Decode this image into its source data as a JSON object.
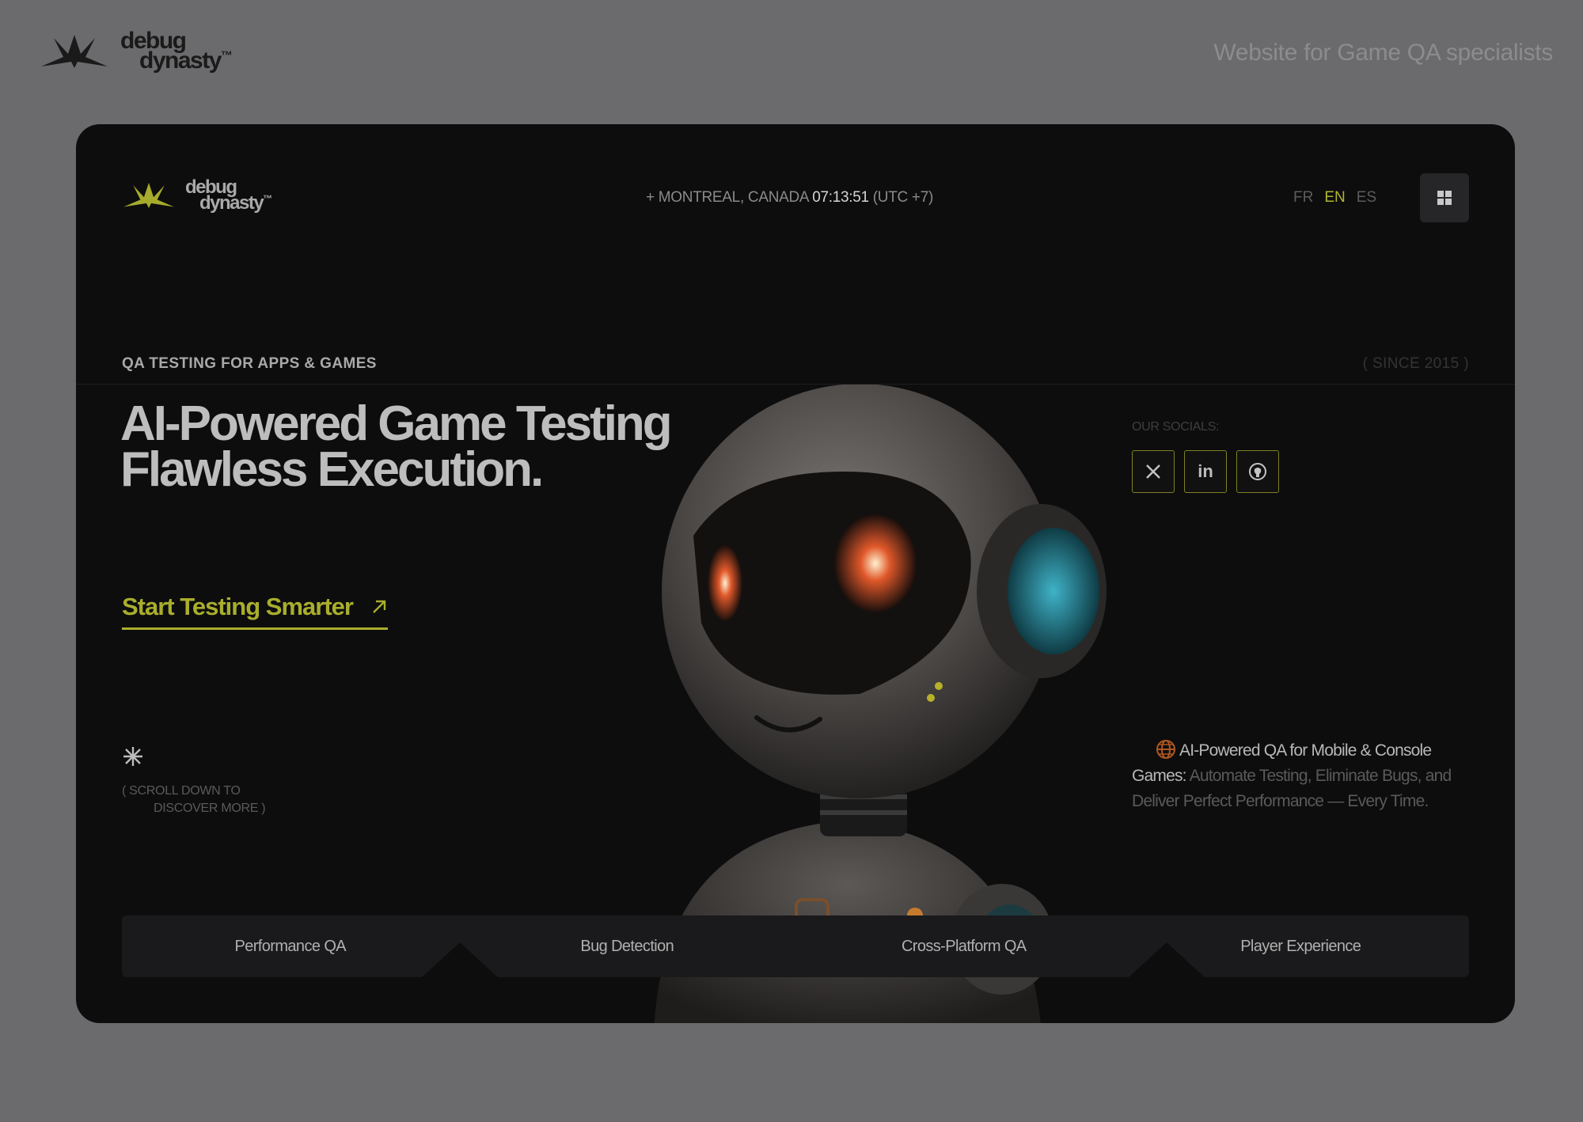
{
  "top": {
    "logo_line1": "debug",
    "logo_line2": "dynasty",
    "logo_tm": "™",
    "tagline": "Website for Game QA specialists"
  },
  "nav": {
    "logo_line1": "debug",
    "logo_line2": "dynasty",
    "logo_tm": "™",
    "location": "+ MONTREAL, CANADA",
    "time": "07:13:51",
    "utc": "(UTC +7)",
    "languages": [
      {
        "label": "FR",
        "active": false
      },
      {
        "label": "EN",
        "active": true
      },
      {
        "label": "ES",
        "active": false
      }
    ],
    "menu_icon": "grid-icon"
  },
  "hero": {
    "eyebrow": "QA TESTING FOR APPS & GAMES",
    "since": "( SINCE 2015 )",
    "headline_line1": "AI-Powered Game Testing",
    "headline_line2": "Flawless Execution.",
    "cta_label": "Start Testing Smarter",
    "cta_icon": "arrow-up-right-icon",
    "scroll_line1": "( SCROLL DOWN TO",
    "scroll_line2": "DISCOVER MORE )"
  },
  "socials": {
    "label": "OUR SOCIALS:",
    "items": [
      {
        "icon": "x-icon",
        "glyph": "𝕏"
      },
      {
        "icon": "linkedin-icon",
        "glyph": "in"
      },
      {
        "icon": "github-icon",
        "glyph": ""
      }
    ]
  },
  "description": {
    "highlight": "AI-Powered QA for Mobile & Console Games:",
    "body": "Automate Testing, Eliminate Bugs, and Deliver Perfect Performance — Every Time."
  },
  "tabs": [
    {
      "label": "Performance QA"
    },
    {
      "label": "Bug Detection"
    },
    {
      "label": "Cross-Platform QA"
    },
    {
      "label": "Player Experience"
    }
  ],
  "colors": {
    "accent": "#a9ae2c",
    "page_bg": "#6b6b6d",
    "card_bg": "#0d0d0e"
  }
}
